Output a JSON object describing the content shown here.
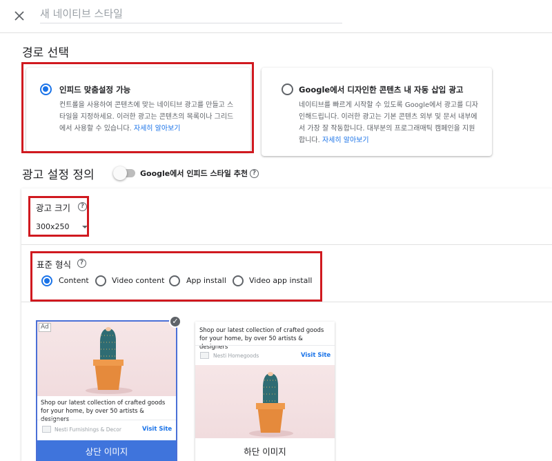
{
  "header": {
    "title_placeholder": "새 네이티브 스타일"
  },
  "route": {
    "heading": "경로 선택",
    "options": [
      {
        "title": "인피드 맞춤설정 가능",
        "description": "컨트롤을 사용하여 콘텐츠에 맞는 네이티브 광고를 만들고 스타일을 지정하세요. 이러한 광고는 콘텐츠의 목록이나 그리드에서 사용할 수 있습니다.",
        "link": "자세히 알아보기",
        "selected": true
      },
      {
        "title": "Google에서 디자인한 콘텐츠 내 자동 삽입 광고",
        "description": "네이티브를 빠르게 시작할 수 있도록 Google에서 광고를 디자인해드립니다. 이러한 광고는 기본 콘텐츠 외부 및 문서 내부에서 가장 잘 작동합니다. 대부분의 프로그래매틱 캠페인을 지원합니다.",
        "link": "자세히 알아보기",
        "selected": false
      }
    ]
  },
  "settings": {
    "heading": "광고 설정 정의",
    "toggle_label": "Google에서 인피드 스타일 추천",
    "toggle_on": false,
    "ad_size_label": "광고 크기",
    "ad_size_value": "300x250",
    "format_label": "표준 형식",
    "formats": [
      {
        "label": "Content",
        "selected": true
      },
      {
        "label": "Video content",
        "selected": false
      },
      {
        "label": "App install",
        "selected": false
      },
      {
        "label": "Video app install",
        "selected": false
      }
    ]
  },
  "previews": [
    {
      "ad_badge": "Ad",
      "text": "Shop our latest collection of crafted goods for your home, by over 50 artists & designers",
      "brand": "Nesti Furnishings & Decor",
      "visit": "Visit Site",
      "footer": "상단 이미지",
      "selected": true
    },
    {
      "text": "Shop our latest collection of crafted goods for your home, by over 50 artists & designers",
      "brand": "Nesti Homegoods",
      "visit": "Visit Site",
      "footer": "하단 이미지",
      "selected": false
    }
  ],
  "colors": {
    "accent": "#1a73e8",
    "highlight_red": "#d0191f",
    "selected_footer": "#3f74dc"
  }
}
